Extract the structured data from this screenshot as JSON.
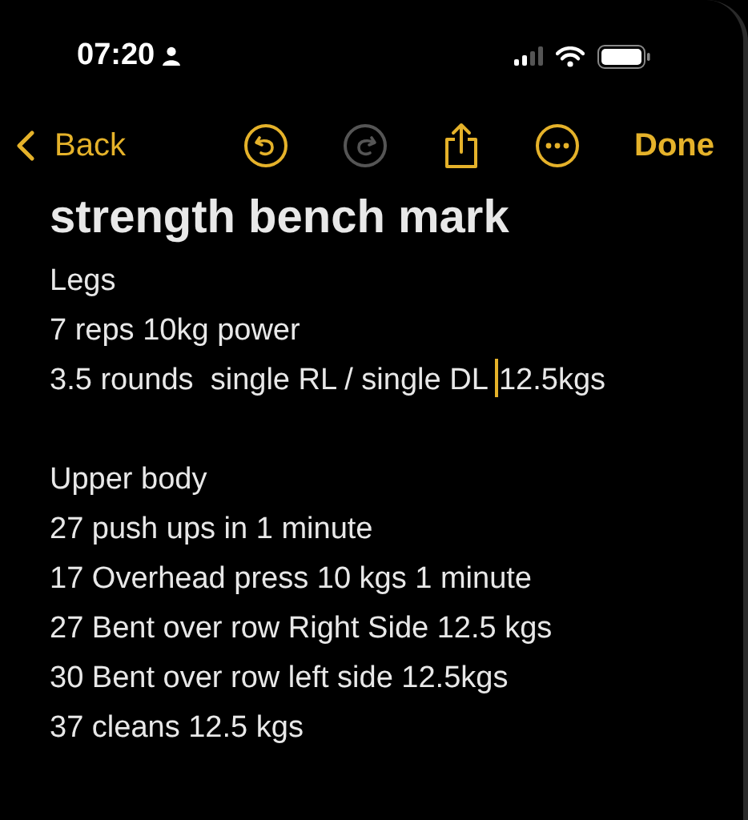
{
  "status_bar": {
    "time": "07:20"
  },
  "toolbar": {
    "back": "Back",
    "done": "Done",
    "buttons": [
      {
        "kind": "undo",
        "disabled": false
      },
      {
        "kind": "redo",
        "disabled": true
      },
      {
        "kind": "share",
        "disabled": false
      },
      {
        "kind": "more",
        "disabled": false
      }
    ]
  },
  "note": {
    "title": "strength bench mark",
    "paragraphs": [
      {
        "lines": [
          {
            "text": "Legs"
          },
          {
            "text": "7 reps 10kg power"
          },
          {
            "text": "3.5 rounds  single RL / single DL ",
            "after_cursor": "12.5kgs"
          }
        ]
      },
      {
        "lines": [
          {
            "text": "Upper body"
          },
          {
            "text": "27 push ups in 1 minute"
          },
          {
            "text": "17 Overhead press 10 kgs 1 minute"
          },
          {
            "text": "27 Bent over row Right Side 12.5 kgs"
          },
          {
            "text": "30 Bent over row left side 12.5kgs"
          },
          {
            "text": "37 cleans 12.5 kgs"
          }
        ]
      }
    ]
  }
}
